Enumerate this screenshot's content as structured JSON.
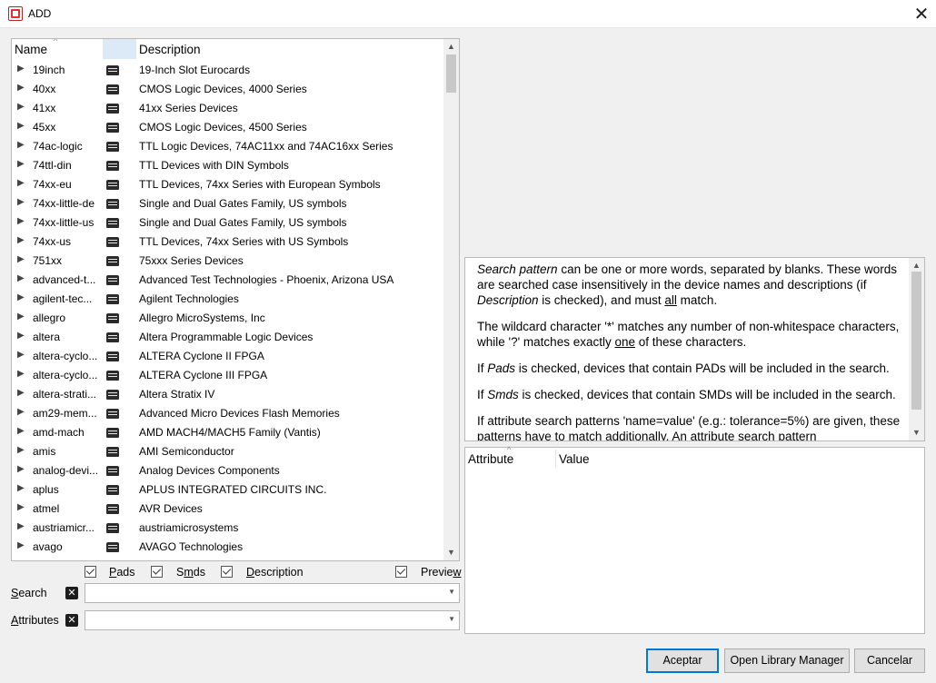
{
  "window": {
    "title": "ADD",
    "close": "✕"
  },
  "tree": {
    "col_name": "Name",
    "col_desc": "Description",
    "rows": [
      {
        "name": "19inch",
        "desc": "19-Inch Slot Eurocards"
      },
      {
        "name": "40xx",
        "desc": "CMOS Logic Devices, 4000 Series"
      },
      {
        "name": "41xx",
        "desc": "41xx Series Devices"
      },
      {
        "name": "45xx",
        "desc": "CMOS Logic Devices, 4500 Series"
      },
      {
        "name": "74ac-logic",
        "desc": "TTL Logic Devices, 74AC11xx and 74AC16xx Series"
      },
      {
        "name": "74ttl-din",
        "desc": "TTL Devices with DIN Symbols"
      },
      {
        "name": "74xx-eu",
        "desc": "TTL Devices, 74xx Series with European Symbols"
      },
      {
        "name": "74xx-little-de",
        "desc": "Single and Dual Gates Family, US symbols"
      },
      {
        "name": "74xx-little-us",
        "desc": "Single and Dual Gates Family, US symbols"
      },
      {
        "name": "74xx-us",
        "desc": "TTL Devices, 74xx Series with US Symbols"
      },
      {
        "name": "751xx",
        "desc": "75xxx Series Devices"
      },
      {
        "name": "advanced-t...",
        "desc": "Advanced Test Technologies - Phoenix, Arizona USA"
      },
      {
        "name": "agilent-tec...",
        "desc": "Agilent Technologies"
      },
      {
        "name": "allegro",
        "desc": "Allegro MicroSystems, Inc"
      },
      {
        "name": "altera",
        "desc": "Altera Programmable Logic Devices"
      },
      {
        "name": "altera-cyclo...",
        "desc": "ALTERA Cyclone II FPGA"
      },
      {
        "name": "altera-cyclo...",
        "desc": "ALTERA Cyclone III FPGA"
      },
      {
        "name": "altera-strati...",
        "desc": "Altera Stratix IV"
      },
      {
        "name": "am29-mem...",
        "desc": "Advanced Micro Devices Flash Memories"
      },
      {
        "name": "amd-mach",
        "desc": "AMD MACH4/MACH5 Family (Vantis)"
      },
      {
        "name": "amis",
        "desc": "AMI Semiconductor"
      },
      {
        "name": "analog-devi...",
        "desc": "Analog Devices Components"
      },
      {
        "name": "aplus",
        "desc": "APLUS INTEGRATED CIRCUITS INC."
      },
      {
        "name": "atmel",
        "desc": "AVR Devices"
      },
      {
        "name": "austriamicr...",
        "desc": "austriamicrosystems"
      },
      {
        "name": "avago",
        "desc": "AVAGO Technologies"
      }
    ]
  },
  "options": {
    "pads_pre": "",
    "pads_key": "P",
    "pads_post": "ads",
    "smds_pre": "S",
    "smds_key": "m",
    "smds_post": "ds",
    "desc_pre": "",
    "desc_key": "D",
    "desc_post": "escription",
    "preview_pre": "Previe",
    "preview_key": "w",
    "preview_post": ""
  },
  "search": {
    "label_key": "S",
    "label_post": "earch",
    "value": ""
  },
  "attributes": {
    "label_key": "A",
    "label_post": "ttributes",
    "value": ""
  },
  "help": {
    "p1_em": "Search pattern",
    "p1_a": " can be one or more words, separated by blanks. These words are searched case insensitively in the device names and descriptions (if ",
    "p1_em2": "Description",
    "p1_b": " is checked), and must ",
    "p1_u": "all",
    "p1_c": " match.",
    "p2_a": "The wildcard character '*' matches any number of non-whitespace characters, while '?' matches exactly ",
    "p2_u": "one",
    "p2_b": " of these characters.",
    "p3_a": "If ",
    "p3_em": "Pads",
    "p3_b": " is checked, devices that contain PADs will be included in the search.",
    "p4_a": "If ",
    "p4_em": "Smds",
    "p4_b": " is checked, devices that contain SMDs will be included in the search.",
    "p5": "If attribute search patterns 'name=value' (e.g.: tolerance=5%) are given, these patterns have to match additionally. An attribute search pattern"
  },
  "attr_table": {
    "col_attribute": "Attribute",
    "col_value": "Value"
  },
  "buttons": {
    "accept": "Aceptar",
    "library_manager": "Open Library Manager",
    "cancel": "Cancelar"
  },
  "colors": {
    "accent": "#0078d7",
    "header_highlight": "#dce9f7"
  }
}
